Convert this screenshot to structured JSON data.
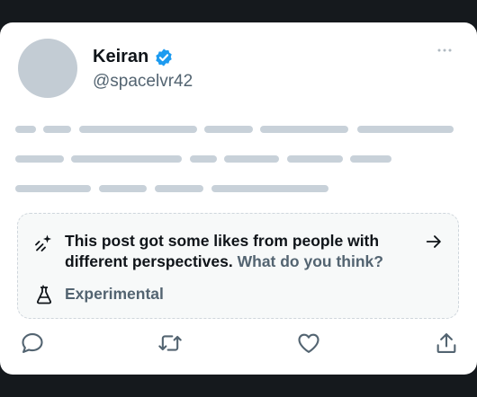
{
  "tweet": {
    "author_name": "Keiran",
    "author_handle": "@spacelvr42",
    "verified_icon": "verified-badge-icon",
    "more_icon": "more-dots-icon"
  },
  "note": {
    "icon": "sparkle-icon",
    "text": "This post got some likes from people with different perspectives.",
    "link_text": "What do you think?",
    "arrow_icon": "arrow-right-icon",
    "experimental_icon": "flask-icon",
    "experimental_label": "Experimental"
  },
  "actions": {
    "reply_icon": "reply-icon",
    "retweet_icon": "retweet-icon",
    "like_icon": "heart-icon",
    "share_icon": "share-icon"
  },
  "colors": {
    "background": "#15191d",
    "card": "#ffffff",
    "verified_blue": "#1d9bf0",
    "primary_text": "#0f1419",
    "secondary_text": "#536471",
    "placeholder": "#c8d1d9"
  }
}
